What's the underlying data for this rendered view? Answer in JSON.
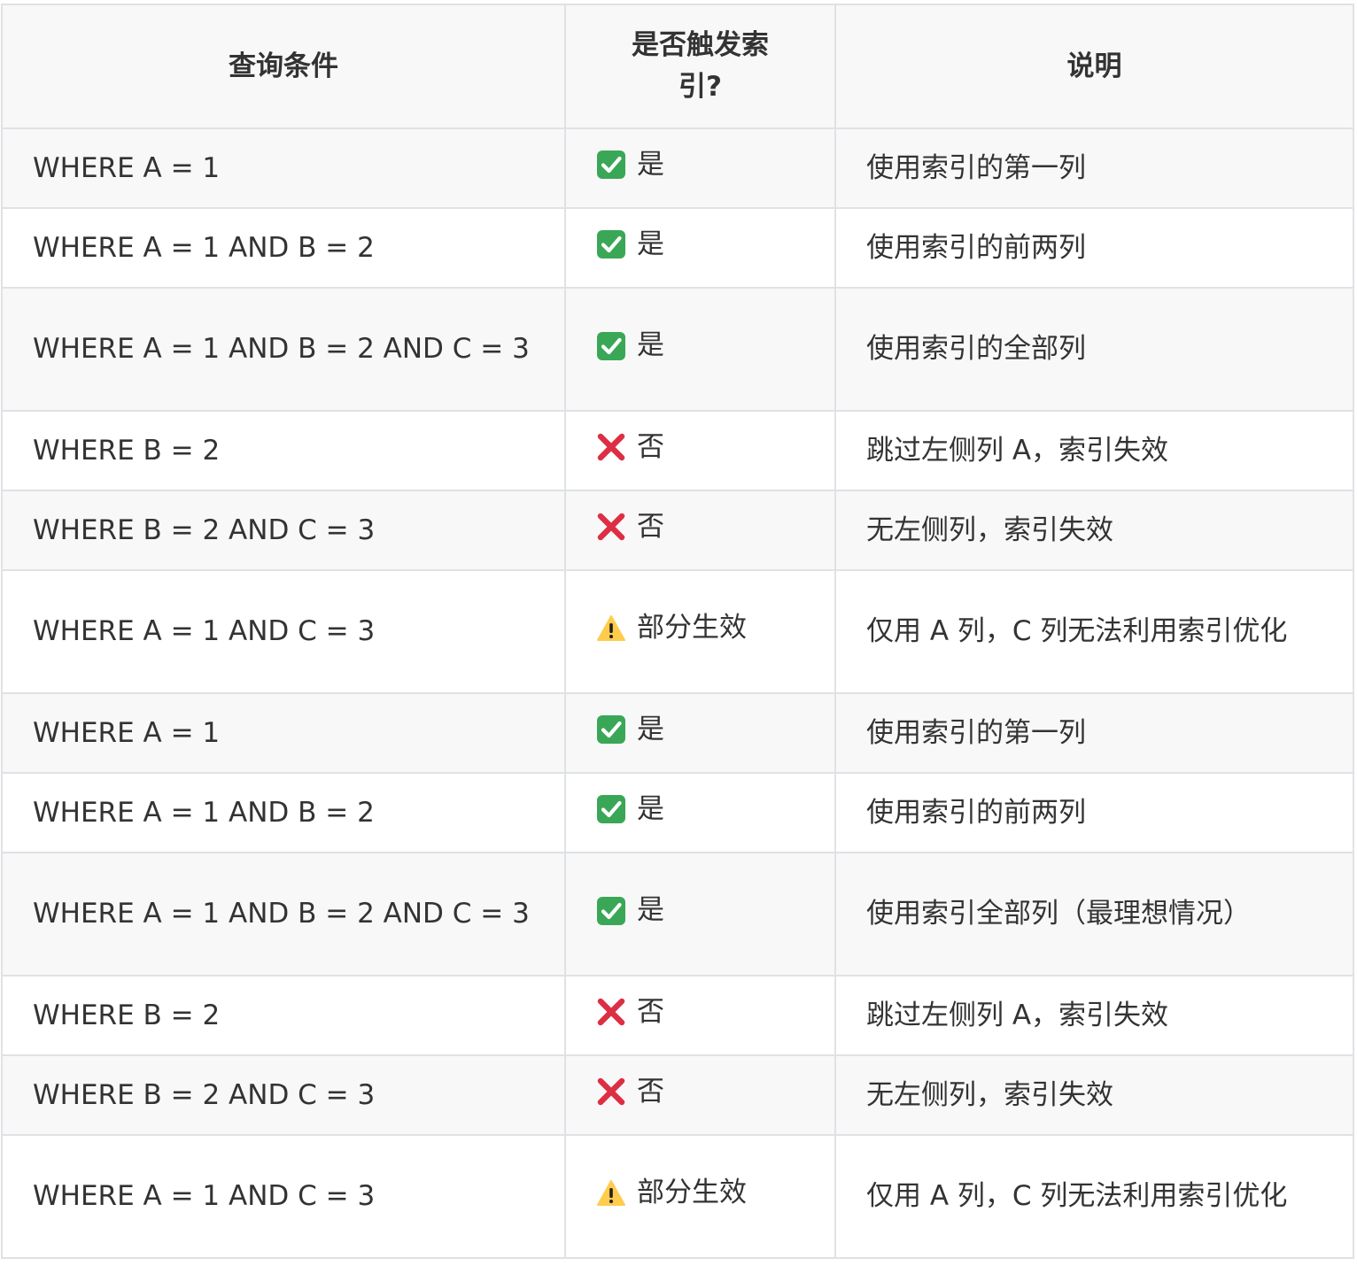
{
  "table": {
    "headers": [
      "查询条件",
      "是否触发索引?",
      "说明"
    ],
    "rows": [
      {
        "condition": "WHERE A = 1",
        "icon": "check-icon",
        "status": "是",
        "note": "使用索引的第一列",
        "tone": "ok"
      },
      {
        "condition": "WHERE A = 1 AND B = 2",
        "icon": "check-icon",
        "status": "是",
        "note": "使用索引的前两列",
        "tone": "ok"
      },
      {
        "condition": "WHERE A = 1 AND B = 2 AND C = 3",
        "icon": "check-icon",
        "status": "是",
        "note": "使用索引的全部列",
        "tone": "ok"
      },
      {
        "condition": "WHERE B = 2",
        "icon": "cross-icon",
        "status": "否",
        "note": "跳过左侧列 A，索引失效",
        "tone": "no"
      },
      {
        "condition": "WHERE B = 2 AND C = 3",
        "icon": "cross-icon",
        "status": "否",
        "note": "无左侧列，索引失效",
        "tone": "no"
      },
      {
        "condition": "WHERE A = 1 AND C = 3",
        "icon": "warning-icon",
        "status": "部分生效",
        "note": "仅用 A 列，C 列无法利用索引优化",
        "tone": "warn"
      },
      {
        "condition": "WHERE A = 1",
        "icon": "check-icon",
        "status": "是",
        "note": "使用索引的第一列",
        "tone": "ok"
      },
      {
        "condition": "WHERE A = 1 AND B = 2",
        "icon": "check-icon",
        "status": "是",
        "note": "使用索引的前两列",
        "tone": "ok"
      },
      {
        "condition": "WHERE A = 1 AND B = 2 AND C = 3",
        "icon": "check-icon",
        "status": "是",
        "note": "使用索引全部列（最理想情况）",
        "tone": "ok"
      },
      {
        "condition": "WHERE B = 2",
        "icon": "cross-icon",
        "status": "否",
        "note": "跳过左侧列 A，索引失效",
        "tone": "no"
      },
      {
        "condition": "WHERE B = 2 AND C = 3",
        "icon": "cross-icon",
        "status": "否",
        "note": "无左侧列，索引失效",
        "tone": "no"
      },
      {
        "condition": "WHERE A = 1 AND C = 3",
        "icon": "warning-icon",
        "status": "部分生效",
        "note": "仅用 A 列，C 列无法利用索引优化",
        "tone": "warn"
      }
    ]
  },
  "colors": {
    "border": "#dfe2e5",
    "stripe": "#f8f8f8",
    "text": "#333333",
    "check": "#3aa757",
    "cross": "#dd2e44",
    "warning": "#ffcc4d"
  }
}
